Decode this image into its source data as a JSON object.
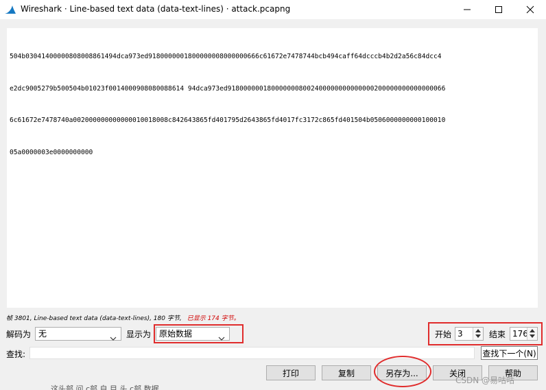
{
  "window": {
    "title": "Wireshark · Line-based text data (data-text-lines) · attack.pcapng"
  },
  "hex_lines": [
    "504b03041400000808008861494dca973ed9180000001800000008000000666c61672e7478744bcb494caff64dcccb4b2d2a56c84dcc4",
    "e2dc9005279b500504b01023f0014000908080088614 94dca973ed9180000001800000008002400000000000000200000000000000066",
    "6c61672e7478740a002000000000000010018008c842643865fd401795d2643865fd4017fc3172c865fd401504b0506000000000100010",
    "05a0000003e0000000000"
  ],
  "status": {
    "frame_info": "帧 3801, Line-based text data (data-text-lines), 180 字节,",
    "shown": "已显示 174 字节。"
  },
  "controls": {
    "decode_as_label": "解码为",
    "decode_as_value": "无",
    "show_as_label": "显示为",
    "show_as_value": "原始数据",
    "start_label": "开始",
    "start_value": "3",
    "end_label": "结束",
    "end_value": "176",
    "find_label": "查找:",
    "find_value": "",
    "find_next_button": "查找下一个(N)"
  },
  "buttons": {
    "print": "打印",
    "copy": "复制",
    "save_as": "另存为...",
    "close": "关闭",
    "help": "帮助"
  },
  "background_text": "这头部 问 c部 自 目 头 c部 数据",
  "watermark": "CSDN @易咕咕"
}
